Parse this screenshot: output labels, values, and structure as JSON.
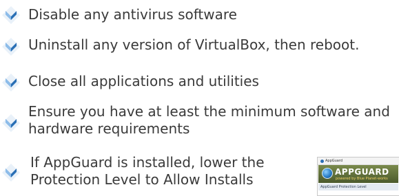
{
  "steps": [
    {
      "text": "Disable any antivirus software"
    },
    {
      "text": "Uninstall any version of VirtualBox, then reboot."
    },
    {
      "text": "Close all applications and utilities"
    },
    {
      "text": "Ensure you have at least the minimum software and hardware requirements"
    },
    {
      "text": "If AppGuard is installed, lower the Protection Level to Allow Installs"
    }
  ],
  "bullet_icon": "blue-chevron-diamond-icon",
  "colors": {
    "text": "#3a3a3a",
    "bullet_light": "#7fb4e6",
    "bullet_dark": "#1f5fa8",
    "appguard_banner": "#5a6a36"
  },
  "appguard_window": {
    "title": "AppGuard",
    "brand": "APPGUARD",
    "tagline": "powered by Blue Planet-works",
    "section_label": "AppGuard Protection Level"
  }
}
